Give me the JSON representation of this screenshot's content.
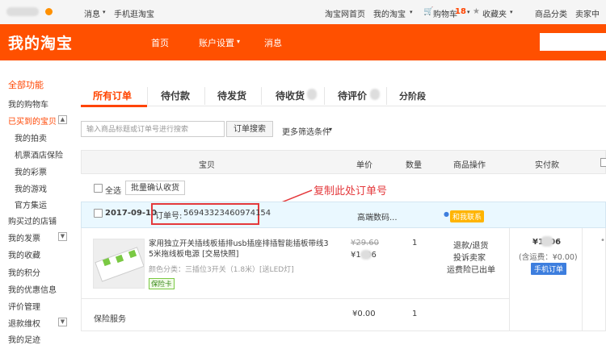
{
  "topbar": {
    "messages": "消息",
    "mobile_taobao": "手机逛淘宝",
    "taobao_home": "淘宝网首页",
    "my_taobao": "我的淘宝",
    "cart_label": "购物车",
    "cart_count": "18",
    "favorites": "收藏夹",
    "categories": "商品分类",
    "seller_center": "卖家中"
  },
  "header": {
    "logo": "我的淘宝",
    "nav": [
      "首页",
      "账户设置",
      "消息"
    ]
  },
  "sidebar": {
    "all_functions": "全部功能",
    "items": [
      {
        "label": "我的购物车"
      },
      {
        "label": "已买到的宝贝"
      },
      {
        "label": "我的拍卖"
      },
      {
        "label": "机票酒店保险"
      },
      {
        "label": "我的彩票"
      },
      {
        "label": "我的游戏"
      },
      {
        "label": "官方集运"
      },
      {
        "label": "购买过的店铺"
      },
      {
        "label": "我的发票"
      },
      {
        "label": "我的收藏"
      },
      {
        "label": "我的积分"
      },
      {
        "label": "我的优惠信息"
      },
      {
        "label": "评价管理"
      },
      {
        "label": "退款维权"
      },
      {
        "label": "我的足迹"
      }
    ]
  },
  "tabs": [
    "所有订单",
    "待付款",
    "待发货",
    "待收货",
    "待评价",
    "分阶段"
  ],
  "filter": {
    "placeholder": "输入商品标题或订单号进行搜索",
    "search_button": "订单搜索",
    "more": "更多筛选条件"
  },
  "table_headers": [
    "宝贝",
    "单价",
    "数量",
    "商品操作",
    "实付款"
  ],
  "select_all": "全选",
  "batch_confirm": "批量确认收货",
  "annotation": "复制此处订单号",
  "order": {
    "date": "2017-09-10",
    "order_no_label": "订单号:",
    "order_no": "56943323460974154",
    "shop": "高端数码...",
    "contact": "和我联系",
    "product_title": "家用独立开关插线板插排usb插座排插智能插板带线3 5米拖线板电源 [交易快照]",
    "spec": "颜色分类：三插位3开关（1.8米）[送LED灯]",
    "insurance_badge": "保险卡",
    "orig_price": "¥29.60",
    "price": "¥1  .06",
    "quantity": "1",
    "actions": [
      "退款/退货",
      "投诉卖家",
      "运费险已出单"
    ],
    "paid": "¥1  .06",
    "shipping": "(含运费：¥0.00)",
    "mobile_order": "手机订单",
    "service_label": "保险服务",
    "service_price": "¥0.00",
    "service_qty": "1"
  }
}
